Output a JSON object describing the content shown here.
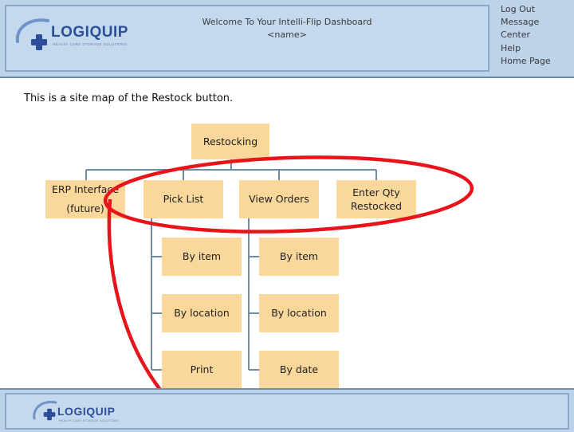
{
  "header": {
    "logo_text": "LOGIQUIP",
    "logo_tagline": "HEALTH CARE STORAGE SOLUTIONS",
    "welcome_line1": "Welcome To Your Intelli-Flip Dashboard",
    "welcome_line2": "<name>",
    "links": [
      "Log Out",
      "Message",
      "Center",
      "Help",
      "Home Page"
    ]
  },
  "intro_text": "This is a site map of the Restock button.",
  "sitemap": {
    "root": "Restocking",
    "erp_line1": "ERP Interface",
    "erp_line2": "(future)",
    "pick_list": "Pick List",
    "view_orders": "View Orders",
    "enter_qty_line1": "Enter Qty",
    "enter_qty_line2": "Restocked",
    "pick_children": [
      "By item",
      "By location",
      "Print"
    ],
    "view_children": [
      "By item",
      "By location",
      "By date"
    ]
  },
  "footer": {
    "logo_text": "LOGIQUIP",
    "logo_tagline": "HEALTH CARE STORAGE SOLUTIONS"
  },
  "colors": {
    "header_bg": "#bcd3ea",
    "box_fill": "#fad79b",
    "connector": "#6f8aa6",
    "highlight_ellipse": "#e8141b",
    "logo_blue": "#2c4f97"
  }
}
